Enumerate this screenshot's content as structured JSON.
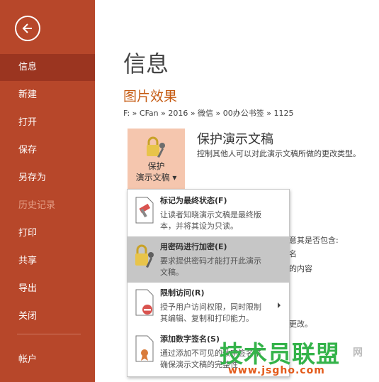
{
  "sidebar": {
    "back_label": "",
    "items": [
      {
        "label": "信息"
      },
      {
        "label": "新建"
      },
      {
        "label": "打开"
      },
      {
        "label": "保存"
      },
      {
        "label": "另存为"
      },
      {
        "label": "历史记录"
      },
      {
        "label": "打印"
      },
      {
        "label": "共享"
      },
      {
        "label": "导出"
      },
      {
        "label": "关闭"
      },
      {
        "label": "帐户"
      }
    ]
  },
  "main": {
    "title": "信息",
    "doc_name": "图片效果",
    "breadcrumb": "F: » CFan » 2016 » 微信 » 00办公书签 » 1125",
    "protect": {
      "button_line1": "保护",
      "button_line2": "演示文稿 ▾",
      "title": "保护演示文稿",
      "description": "控制其他人可以对此演示文稿所做的更改类型。"
    },
    "partial_texts": [
      "意其是否包含:",
      "名",
      "的内容",
      "更改。"
    ]
  },
  "menu": {
    "items": [
      {
        "title": "标记为最终状态(F)",
        "desc1": "让读者知晓演示文稿是最终版",
        "desc2": "本，并将其设为只读。",
        "icon": "mark-final-icon"
      },
      {
        "title": "用密码进行加密(E)",
        "desc1": "要求提供密码才能打开此演示",
        "desc2": "文稿。",
        "icon": "lock-key-icon"
      },
      {
        "title": "限制访问(R)",
        "desc1": "授予用户访问权限，同时限制",
        "desc2": "其编辑、复制和打印能力。",
        "icon": "restrict-access-icon"
      },
      {
        "title": "添加数字签名(S)",
        "desc1": "通过添加不可见的数字签名来",
        "desc2": "确保演示文稿的完整性",
        "icon": "digital-signature-icon"
      }
    ]
  },
  "watermark": {
    "name": "技术员联盟",
    "net": "网",
    "url": "www.jsgho.com"
  },
  "colors": {
    "sidebar_bg": "#b7472a",
    "sidebar_active": "#9b3520",
    "accent_orange": "#c55a11",
    "protect_button_bg": "#f5c6ae",
    "menu_hover": "#c6c6c6"
  }
}
